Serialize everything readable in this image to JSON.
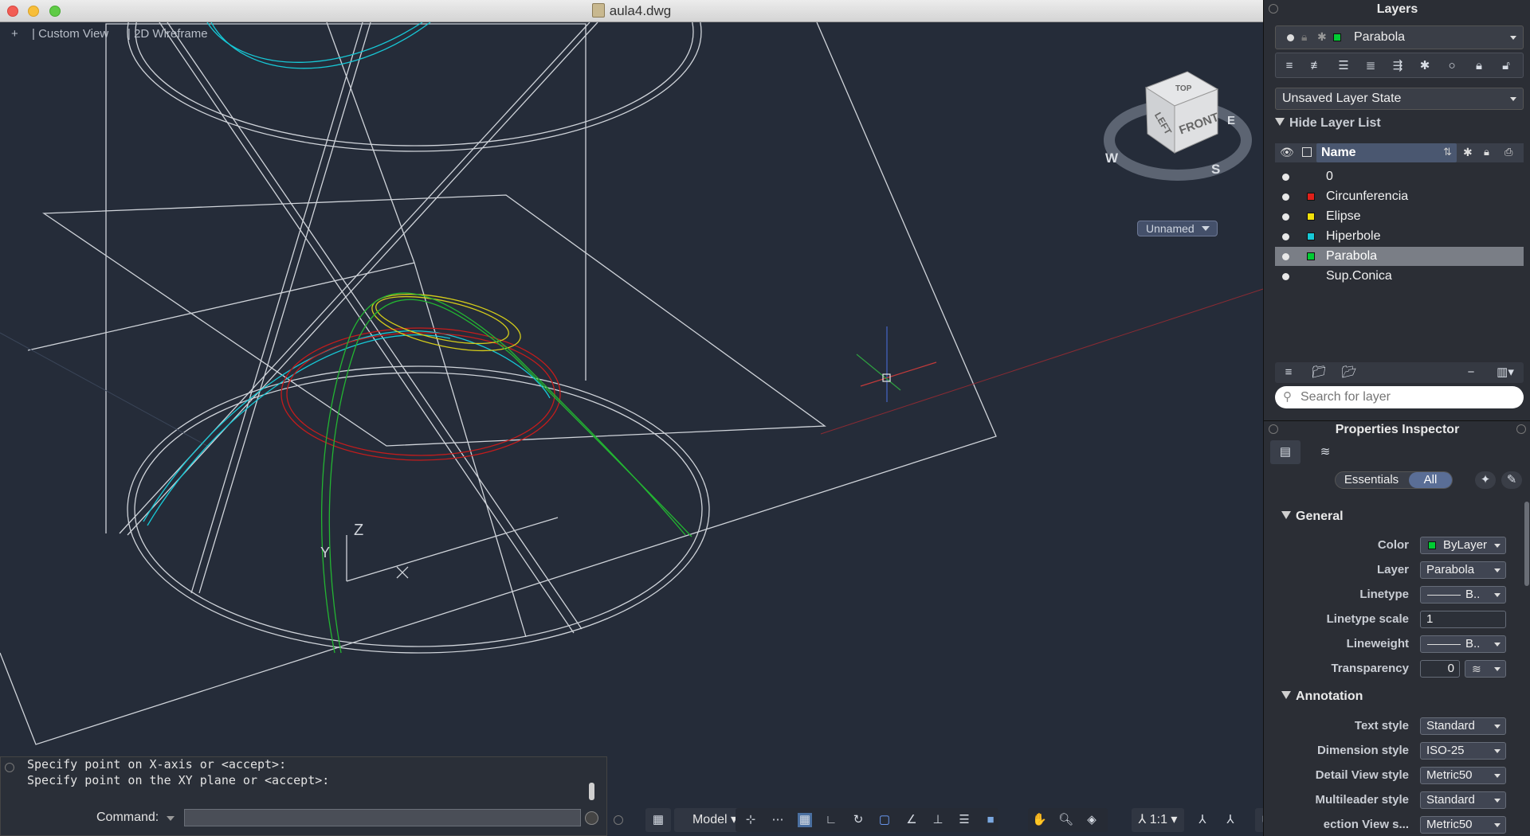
{
  "window": {
    "title": "aula4.dwg"
  },
  "viewport": {
    "view_controls": [
      "+",
      "Custom View",
      "2D Wireframe"
    ],
    "viewcube": {
      "top": "TOP",
      "left": "LEFT",
      "front": "FRONT",
      "compass_w": "W",
      "compass_s": "S",
      "compass_e": "E"
    },
    "ucs_label": "Unnamed",
    "ucs_icon": {
      "z": "Z",
      "y": "Y"
    }
  },
  "command_line": {
    "history": [
      "Specify point on X-axis or <accept>:",
      "Specify point on the XY plane or <accept>:"
    ],
    "label": "Command:",
    "value": ""
  },
  "status_bar": {
    "model_label": "Model",
    "scale_label": "1:1"
  },
  "layers_panel": {
    "title": "Layers",
    "current_layer": "Parabola",
    "current_layer_color": "#00cc33",
    "layer_state": "Unsaved Layer State",
    "hide_list_label": "Hide Layer List",
    "column_name": "Name",
    "layers": [
      {
        "name": "0",
        "color": ""
      },
      {
        "name": "Circunferencia",
        "color": "#e0201a"
      },
      {
        "name": "Elipse",
        "color": "#f2e10a"
      },
      {
        "name": "Hiperbole",
        "color": "#17c8d6"
      },
      {
        "name": "Parabola",
        "color": "#00cc33",
        "selected": true
      },
      {
        "name": "Sup.Conica",
        "color": ""
      }
    ],
    "search_placeholder": "Search for layer"
  },
  "properties_panel": {
    "title": "Properties Inspector",
    "tabs": [
      "Essentials",
      "All"
    ],
    "general": {
      "heading": "General",
      "rows": [
        {
          "label": "Color",
          "value": "ByLayer",
          "swatch": "#00cc33"
        },
        {
          "label": "Layer",
          "value": "Parabola"
        },
        {
          "label": "Linetype",
          "value": "B.."
        },
        {
          "label": "Linetype scale",
          "value": "1"
        },
        {
          "label": "Lineweight",
          "value": "B.."
        },
        {
          "label": "Transparency",
          "value": "0"
        }
      ]
    },
    "annotation": {
      "heading": "Annotation",
      "rows": [
        {
          "label": "Text style",
          "value": "Standard"
        },
        {
          "label": "Dimension style",
          "value": "ISO-25"
        },
        {
          "label": "Detail View style",
          "value": "Metric50"
        },
        {
          "label": "Multileader style",
          "value": "Standard"
        },
        {
          "label": "ection View s...",
          "value": "Metric50"
        }
      ]
    }
  }
}
